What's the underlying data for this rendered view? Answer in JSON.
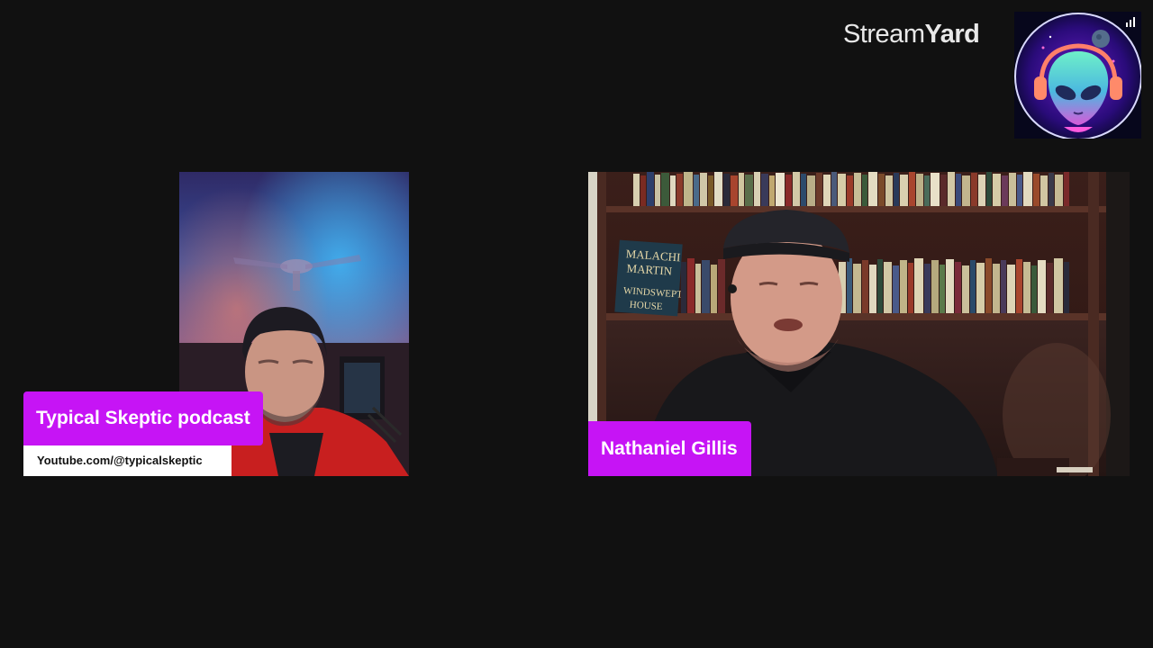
{
  "branding": {
    "name_part1": "Stream",
    "name_part2": "Yard"
  },
  "participants": [
    {
      "name": "Typical Skeptic podcast",
      "subtitle": "Youtube.com/@typicalskeptic"
    },
    {
      "name": "Nathaniel Gillis"
    }
  ],
  "book_spine": {
    "line1": "MALACHI",
    "line2": "MARTIN",
    "line3": "WINDSWEPT",
    "line4": "HOUSE"
  },
  "colors": {
    "background": "#111111",
    "accent": "#c614f5",
    "subtitle_bg": "#ffffff"
  },
  "icons": [
    "alien-logo-icon",
    "signal-icon"
  ]
}
